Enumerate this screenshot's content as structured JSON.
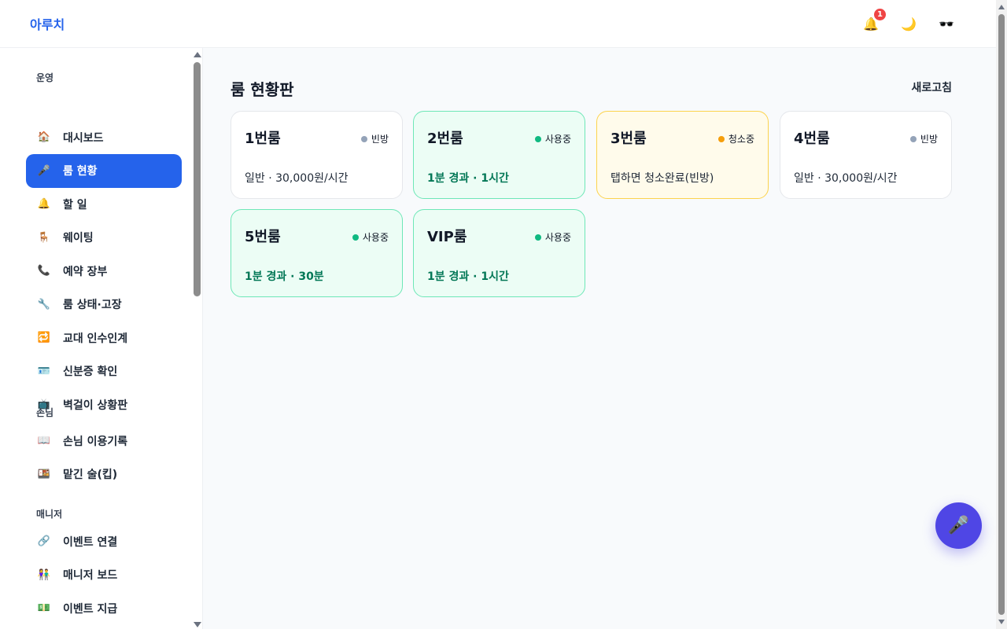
{
  "header": {
    "brand": "아루치",
    "notification_count": "1",
    "icons": [
      "bell-icon",
      "moon-icon",
      "glasses-icon"
    ]
  },
  "sidebar": {
    "sections": [
      {
        "title": "운영",
        "items": [
          {
            "icon": "🏠",
            "label": "대시보드"
          },
          {
            "icon": "🎤",
            "label": "룸 현황",
            "active": true
          },
          {
            "icon": "🔔",
            "label": "할 일"
          },
          {
            "icon": "🪑",
            "label": "웨이팅"
          },
          {
            "icon": "📞",
            "label": "예약 장부"
          },
          {
            "icon": "🔧",
            "label": "룸 상태·고장"
          },
          {
            "icon": "🔁",
            "label": "교대 인수인계"
          },
          {
            "icon": "🪪",
            "label": "신분증 확인"
          },
          {
            "icon": "📺",
            "label": "벽걸이 상황판"
          }
        ]
      },
      {
        "title": "손님",
        "items": [
          {
            "icon": "📖",
            "label": "손님 이용기록"
          },
          {
            "icon": "🍱",
            "label": "맡긴 술(킵)"
          }
        ]
      },
      {
        "title": "매니저",
        "items": [
          {
            "icon": "🔗",
            "label": "이벤트 연결"
          },
          {
            "icon": "👫",
            "label": "매니저 보드"
          },
          {
            "icon": "💵",
            "label": "이벤트 지급"
          }
        ]
      }
    ]
  },
  "main": {
    "title": "룸 현황판",
    "refresh_label": "새로고침",
    "rooms": [
      {
        "name": "1번룸",
        "status": "빈방",
        "status_color": "#94a3b8",
        "state": "empty",
        "info": "일반 · 30,000원/시간"
      },
      {
        "name": "2번룸",
        "status": "사용중",
        "status_color": "#10b981",
        "state": "busy",
        "info": "1분 경과 · 1시간"
      },
      {
        "name": "3번룸",
        "status": "청소중",
        "status_color": "#f59e0b",
        "state": "cleaning",
        "info": "탭하면 청소완료(빈방)"
      },
      {
        "name": "4번룸",
        "status": "빈방",
        "status_color": "#94a3b8",
        "state": "empty",
        "info": "일반 · 30,000원/시간"
      },
      {
        "name": "5번룸",
        "status": "사용중",
        "status_color": "#10b981",
        "state": "busy",
        "info": "1분 경과 · 30분"
      },
      {
        "name": "VIP룸",
        "status": "사용중",
        "status_color": "#10b981",
        "state": "busy",
        "info": "1분 경과 · 1시간"
      }
    ]
  },
  "fab": {
    "icon": "🎤"
  }
}
